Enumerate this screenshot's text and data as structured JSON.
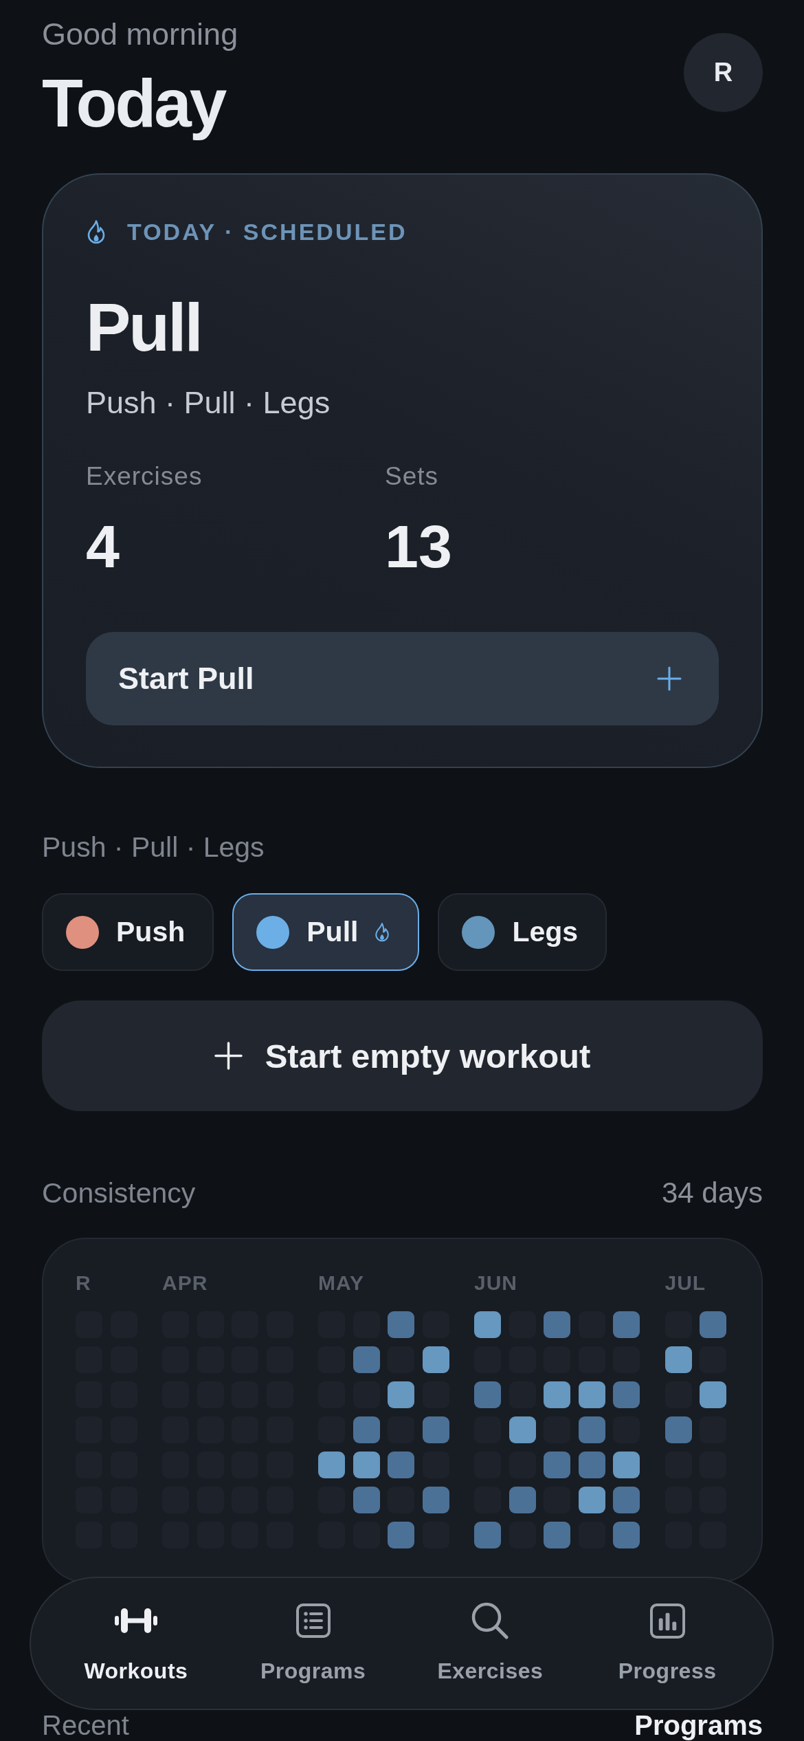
{
  "header": {
    "greeting": "Good morning",
    "title": "Today",
    "avatar_initial": "R"
  },
  "today_card": {
    "tag": "TODAY · SCHEDULED",
    "title": "Pull",
    "program": "Push · Pull · Legs",
    "stats": [
      {
        "label": "Exercises",
        "value": "4"
      },
      {
        "label": "Sets",
        "value": "13"
      }
    ],
    "start_button": "Start Pull"
  },
  "program": {
    "title": "Push · Pull · Legs",
    "days": [
      {
        "label": "Push",
        "color": "#e0907f",
        "selected": false,
        "scheduled": false
      },
      {
        "label": "Pull",
        "color": "#6cafe6",
        "selected": true,
        "scheduled": true
      },
      {
        "label": "Legs",
        "color": "#6495bb",
        "selected": false,
        "scheduled": false
      }
    ]
  },
  "empty_workout_button": "Start empty workout",
  "consistency": {
    "title": "Consistency",
    "count": "34 days",
    "months": [
      {
        "label": "R",
        "weeks": [
          {
            "days": [
              {
                "kind": "empty"
              },
              {
                "kind": "empty"
              },
              {
                "kind": "empty"
              },
              {
                "kind": "empty"
              },
              {
                "kind": "empty"
              },
              {
                "kind": "empty"
              },
              {
                "kind": "empty"
              }
            ]
          },
          {
            "days": [
              {
                "kind": "empty"
              },
              {
                "kind": "empty"
              },
              {
                "kind": "empty"
              },
              {
                "kind": "empty"
              },
              {
                "kind": "empty"
              },
              {
                "kind": "empty"
              },
              {
                "kind": "empty"
              }
            ]
          }
        ]
      },
      {
        "label": "APR",
        "weeks": [
          {
            "days": [
              {
                "kind": "empty"
              },
              {
                "kind": "empty"
              },
              {
                "kind": "empty"
              },
              {
                "kind": "empty"
              },
              {
                "kind": "empty"
              },
              {
                "kind": "empty"
              },
              {
                "kind": "empty"
              }
            ]
          },
          {
            "days": [
              {
                "kind": "empty"
              },
              {
                "kind": "empty"
              },
              {
                "kind": "empty"
              },
              {
                "kind": "empty"
              },
              {
                "kind": "empty"
              },
              {
                "kind": "empty"
              },
              {
                "kind": "empty"
              }
            ]
          },
          {
            "days": [
              {
                "kind": "empty"
              },
              {
                "kind": "empty"
              },
              {
                "kind": "empty"
              },
              {
                "kind": "empty"
              },
              {
                "kind": "empty"
              },
              {
                "kind": "empty"
              },
              {
                "kind": "empty"
              }
            ]
          },
          {
            "days": [
              {
                "kind": "empty"
              },
              {
                "kind": "empty"
              },
              {
                "kind": "empty"
              },
              {
                "kind": "empty"
              },
              {
                "kind": "empty"
              },
              {
                "kind": "empty"
              },
              {
                "kind": "empty"
              }
            ]
          }
        ]
      },
      {
        "label": "MAY",
        "weeks": [
          {
            "days": [
              {
                "kind": "empty"
              },
              {
                "kind": "empty"
              },
              {
                "kind": "empty"
              },
              {
                "kind": "empty"
              },
              {
                "kind": "high"
              },
              {
                "kind": "empty"
              },
              {
                "kind": "empty"
              }
            ]
          },
          {
            "days": [
              {
                "kind": "empty"
              },
              {
                "kind": "medium"
              },
              {
                "kind": "empty"
              },
              {
                "kind": "medium"
              },
              {
                "kind": "high"
              },
              {
                "kind": "medium"
              },
              {
                "kind": "empty"
              }
            ]
          },
          {
            "days": [
              {
                "kind": "medium"
              },
              {
                "kind": "empty"
              },
              {
                "kind": "high"
              },
              {
                "kind": "empty"
              },
              {
                "kind": "medium"
              },
              {
                "kind": "empty"
              },
              {
                "kind": "medium"
              }
            ]
          },
          {
            "days": [
              {
                "kind": "empty"
              },
              {
                "kind": "high"
              },
              {
                "kind": "empty"
              },
              {
                "kind": "medium"
              },
              {
                "kind": "empty"
              },
              {
                "kind": "medium"
              },
              {
                "kind": "empty"
              }
            ]
          }
        ]
      },
      {
        "label": "JUN",
        "weeks": [
          {
            "days": [
              {
                "kind": "high"
              },
              {
                "kind": "empty"
              },
              {
                "kind": "medium"
              },
              {
                "kind": "empty"
              },
              {
                "kind": "empty"
              },
              {
                "kind": "empty"
              },
              {
                "kind": "medium"
              }
            ]
          },
          {
            "days": [
              {
                "kind": "empty"
              },
              {
                "kind": "empty"
              },
              {
                "kind": "empty"
              },
              {
                "kind": "high"
              },
              {
                "kind": "empty"
              },
              {
                "kind": "medium"
              },
              {
                "kind": "empty"
              }
            ]
          },
          {
            "days": [
              {
                "kind": "medium"
              },
              {
                "kind": "empty"
              },
              {
                "kind": "high"
              },
              {
                "kind": "empty"
              },
              {
                "kind": "medium"
              },
              {
                "kind": "empty"
              },
              {
                "kind": "medium"
              }
            ]
          },
          {
            "days": [
              {
                "kind": "empty"
              },
              {
                "kind": "empty"
              },
              {
                "kind": "high"
              },
              {
                "kind": "medium"
              },
              {
                "kind": "medium"
              },
              {
                "kind": "high"
              },
              {
                "kind": "empty"
              }
            ]
          },
          {
            "days": [
              {
                "kind": "medium"
              },
              {
                "kind": "empty"
              },
              {
                "kind": "medium"
              },
              {
                "kind": "empty"
              },
              {
                "kind": "high"
              },
              {
                "kind": "medium"
              },
              {
                "kind": "medium"
              }
            ]
          }
        ]
      },
      {
        "label": "JUL",
        "weeks": [
          {
            "days": [
              {
                "kind": "empty"
              },
              {
                "kind": "high"
              },
              {
                "kind": "empty"
              },
              {
                "kind": "medium"
              },
              {
                "kind": "empty"
              },
              {
                "kind": "empty"
              },
              {
                "kind": "empty"
              }
            ]
          },
          {
            "days": [
              {
                "kind": "medium"
              },
              {
                "kind": "empty"
              },
              {
                "kind": "high"
              },
              {
                "kind": "empty"
              },
              {
                "kind": "empty"
              },
              {
                "kind": "empty"
              },
              {
                "kind": "empty"
              }
            ]
          }
        ]
      }
    ]
  },
  "recent": {
    "title": "Recent",
    "link": "Programs"
  },
  "tab_bar": {
    "tabs": [
      {
        "label": "Workouts",
        "selected": true
      },
      {
        "label": "Programs",
        "selected": false
      },
      {
        "label": "Exercises",
        "selected": false
      },
      {
        "label": "Progress",
        "selected": false
      }
    ]
  }
}
